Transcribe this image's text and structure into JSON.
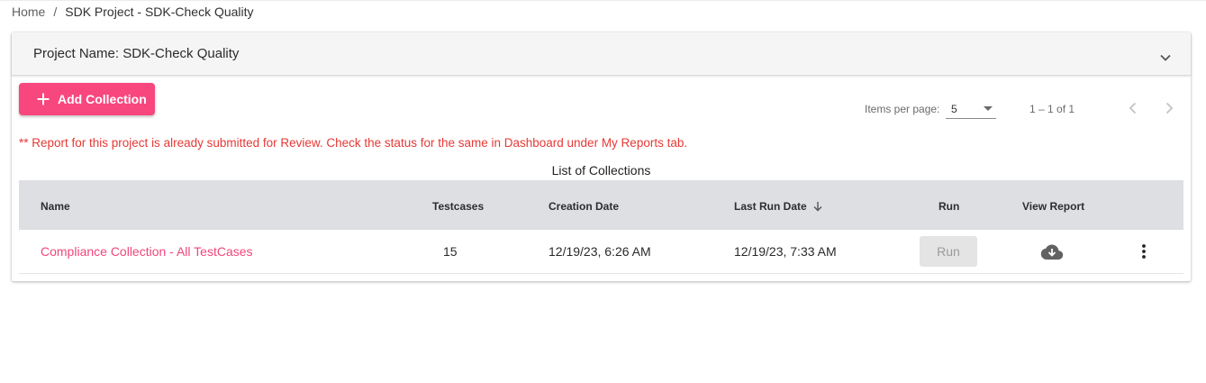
{
  "breadcrumb": {
    "home": "Home",
    "separator": "/",
    "current": "SDK Project - SDK-Check Quality"
  },
  "panel": {
    "title": "Project Name: SDK-Check Quality",
    "toggle_icon": "chevron-down-icon"
  },
  "toolbar": {
    "add_label": "Add Collection",
    "add_icon": "plus-icon",
    "accent": "#f8467f"
  },
  "paginator": {
    "items_per_page_label": "Items per page:",
    "items_per_page_value": "5",
    "range": "1 – 1 of 1"
  },
  "warning": {
    "text": "** Report for this project is already submitted for Review. Check the status for the same in Dashboard under My Reports tab.",
    "color": "#e53935"
  },
  "table": {
    "caption": "List of Collections",
    "headers": {
      "name": "Name",
      "testcases": "Testcases",
      "creation_date": "Creation Date",
      "last_run_date": "Last Run Date",
      "run": "Run",
      "view_report": "View Report"
    },
    "sort_icon": "arrow-down-icon",
    "rows": [
      {
        "name": "Compliance Collection - All TestCases",
        "testcases": "15",
        "creation_date": "12/19/23, 6:26 AM",
        "last_run_date": "12/19/23, 7:33 AM",
        "run_label": "Run",
        "report_icon": "cloud-download-icon",
        "menu_icon": "more-vert-icon"
      }
    ]
  }
}
